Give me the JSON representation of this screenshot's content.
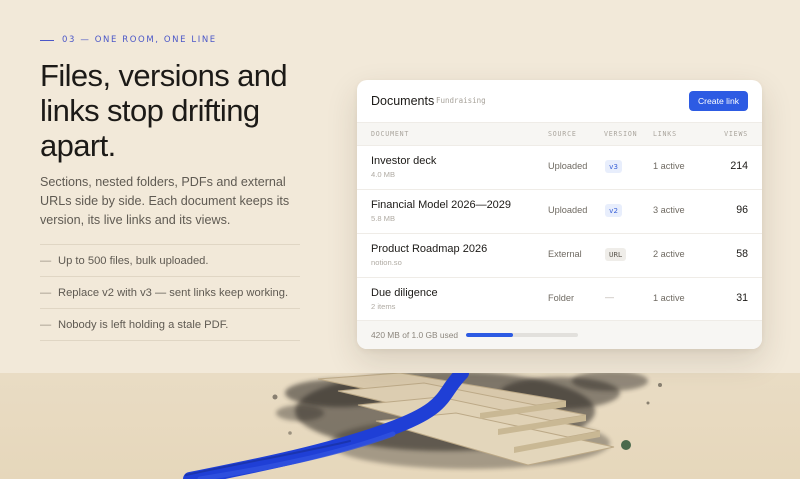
{
  "section": {
    "eyebrow": "03 — ONE ROOM, ONE LINE",
    "headline": "Files, versions and links stop drifting apart.",
    "lede": "Sections, nested folders, PDFs and external URLs side by side. Each document keeps its version, its live links and its views.",
    "bullets": [
      "Up to 500 files, bulk uploaded.",
      "Replace v2 with v3 — sent links keep working.",
      "Nobody is left holding a stale PDF."
    ],
    "bullet_marker": "—"
  },
  "panel": {
    "title": "Documents",
    "tag": "Fundraising",
    "create_button": "Create link",
    "columns": {
      "document": "DOCUMENT",
      "source": "SOURCE",
      "version": "VERSION",
      "links": "LINKS",
      "views": "VIEWS"
    },
    "rows": [
      {
        "name": "Investor deck",
        "meta": "4.0 MB",
        "source": "Uploaded",
        "version": "v3",
        "links": "1 active",
        "views": "214"
      },
      {
        "name": "Financial Model 2026—2029",
        "meta": "5.8 MB",
        "source": "Uploaded",
        "version": "v2",
        "links": "3 active",
        "views": "96"
      },
      {
        "name": "Product Roadmap 2026",
        "meta": "notion.so",
        "source": "External",
        "version": "URL",
        "links": "2 active",
        "views": "58"
      },
      {
        "name": "Due diligence",
        "meta": "2 items",
        "source": "Folder",
        "version": "—",
        "links": "1 active",
        "views": "31"
      }
    ],
    "storage": {
      "label": "420 MB of 1.0 GB used",
      "used_fraction": 0.42
    }
  },
  "colors": {
    "background": "#f2e9d9",
    "accent_blue": "#2d5be3",
    "eyebrow": "#4b57c8",
    "ink_stroke": "#1f3fd6"
  }
}
